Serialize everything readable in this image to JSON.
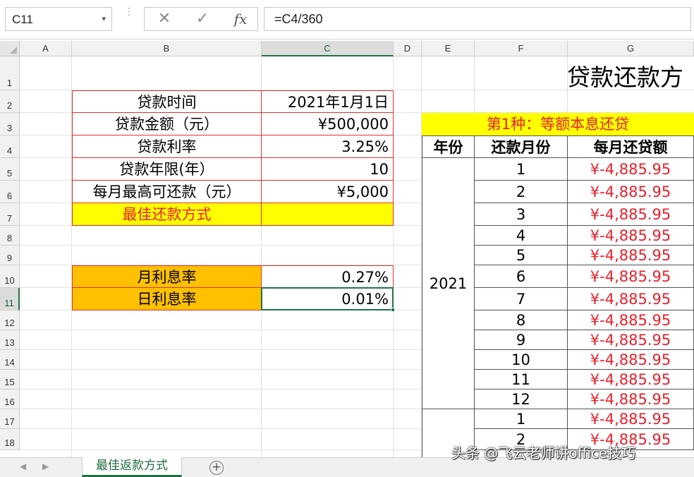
{
  "formula_bar": {
    "name_box": "C11",
    "name_box_arrow": "▾",
    "dots": "⋮",
    "cancel_icon": "✕",
    "enter_icon": "✓",
    "fx_label": "fx",
    "formula": "=C4/360"
  },
  "sheet": {
    "columns": [
      "A",
      "B",
      "C",
      "D",
      "E",
      "F",
      "G"
    ],
    "rows": [
      "1",
      "2",
      "3",
      "4",
      "5",
      "6",
      "7",
      "8",
      "9",
      "10",
      "11",
      "12",
      "13",
      "14",
      "15",
      "16",
      "17",
      "18"
    ],
    "selected_column": "C",
    "selected_row": "11",
    "title": "贷款还款方",
    "params": [
      {
        "label": "贷款时间",
        "value": "2021年1月1日"
      },
      {
        "label": "贷款金额（元）",
        "value": "¥500,000"
      },
      {
        "label": "贷款利率",
        "value": "3.25%"
      },
      {
        "label": "贷款年限(年）",
        "value": "10"
      },
      {
        "label": "每月最高可还款（元）",
        "value": "¥5,000"
      },
      {
        "label": "最佳还款方式",
        "value": ""
      }
    ],
    "rates": [
      {
        "label": "月利息率",
        "value": "0.27%"
      },
      {
        "label": "日利息率",
        "value": "0.01%"
      }
    ],
    "schedule": {
      "heading": "第1种：等额本息还贷",
      "headers": [
        "年份",
        "还款月份",
        "每月还贷额"
      ],
      "year": "2021",
      "months": [
        "1",
        "2",
        "3",
        "4",
        "5",
        "6",
        "7",
        "8",
        "9",
        "10",
        "11",
        "12",
        "1",
        "2"
      ],
      "payment": "¥-4,885.95"
    }
  },
  "tabs": {
    "prev_icon": "◀",
    "next_icon": "▶",
    "active": "最佳返款方式",
    "add_icon": "+"
  },
  "watermark": "头条 @飞云老师讲office技巧",
  "colors": {
    "accent_green": "#217346",
    "yellow": "#ffff00",
    "orange": "#ffc000",
    "red_text": "#e8202a"
  }
}
